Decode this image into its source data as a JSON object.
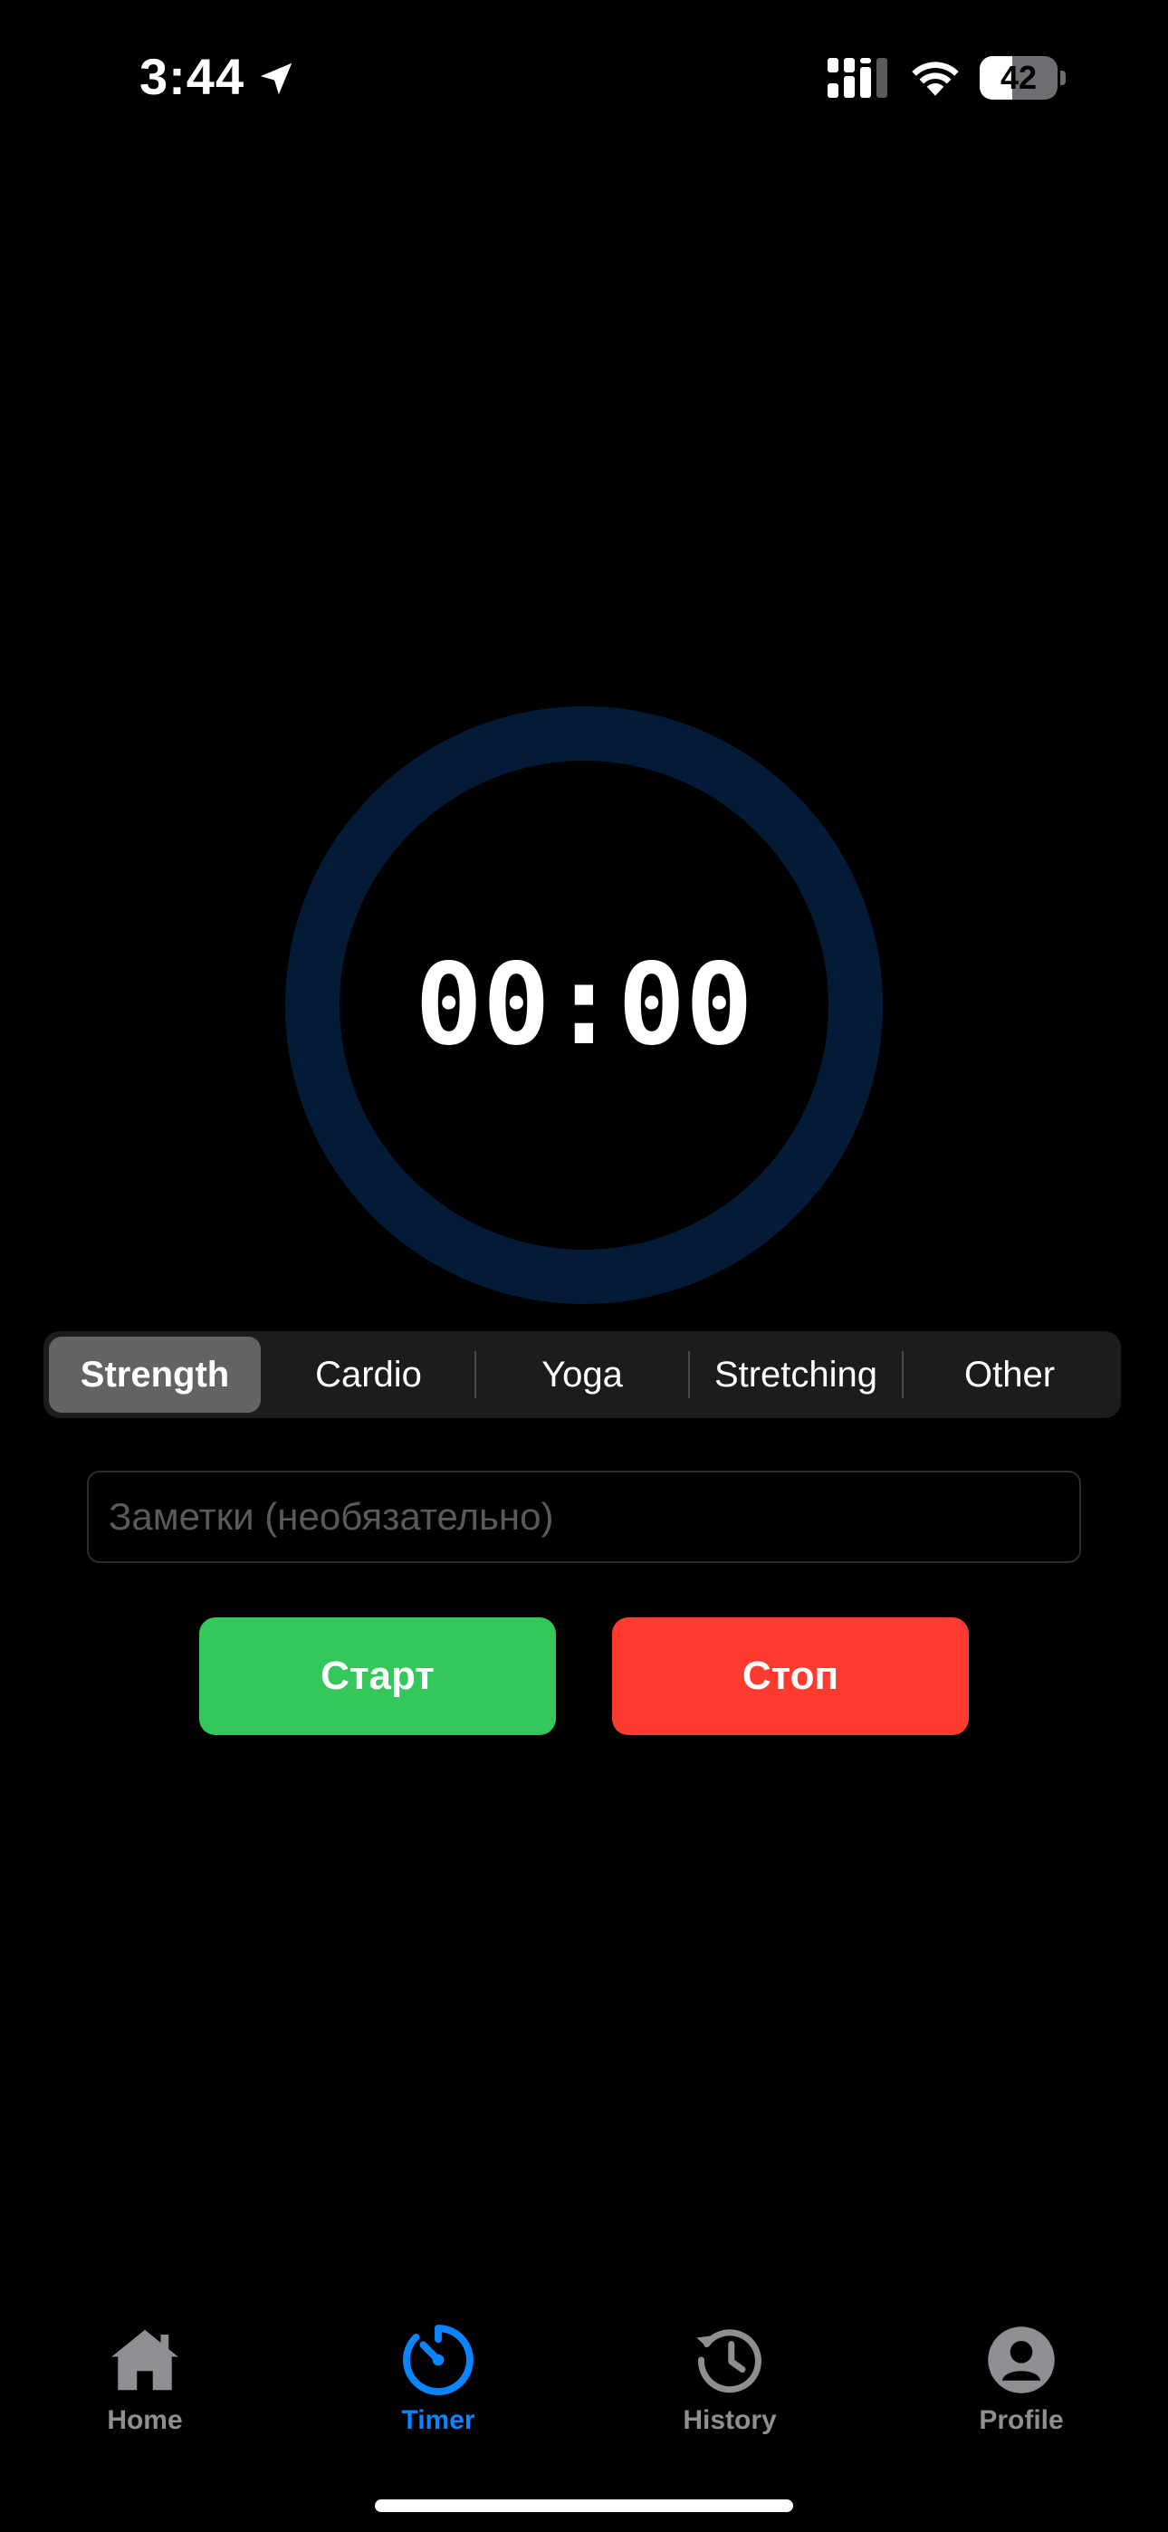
{
  "status_bar": {
    "time": "3:44",
    "battery_level": "42",
    "battery_fraction": 0.42,
    "icons": [
      "location-arrow-icon",
      "cellular-signal-icon",
      "wifi-icon",
      "battery-icon"
    ]
  },
  "timer": {
    "display": "00:00",
    "progress": 0,
    "ring_color": "#031b36"
  },
  "workout_types": {
    "selected": "Strength",
    "options": [
      "Strength",
      "Cardio",
      "Yoga",
      "Stretching",
      "Other"
    ]
  },
  "notes": {
    "placeholder": "Заметки (необязательно)",
    "value": ""
  },
  "actions": {
    "start_label": "Старт",
    "stop_label": "Стоп",
    "start_color": "#34c759",
    "stop_color": "#ff3b30"
  },
  "tab_bar": {
    "active": "Timer",
    "accent_color": "#0a84ff",
    "items": [
      {
        "label": "Home",
        "icon": "house-icon"
      },
      {
        "label": "Timer",
        "icon": "timer-icon"
      },
      {
        "label": "History",
        "icon": "history-clock-icon"
      },
      {
        "label": "Profile",
        "icon": "person-circle-icon"
      }
    ]
  }
}
